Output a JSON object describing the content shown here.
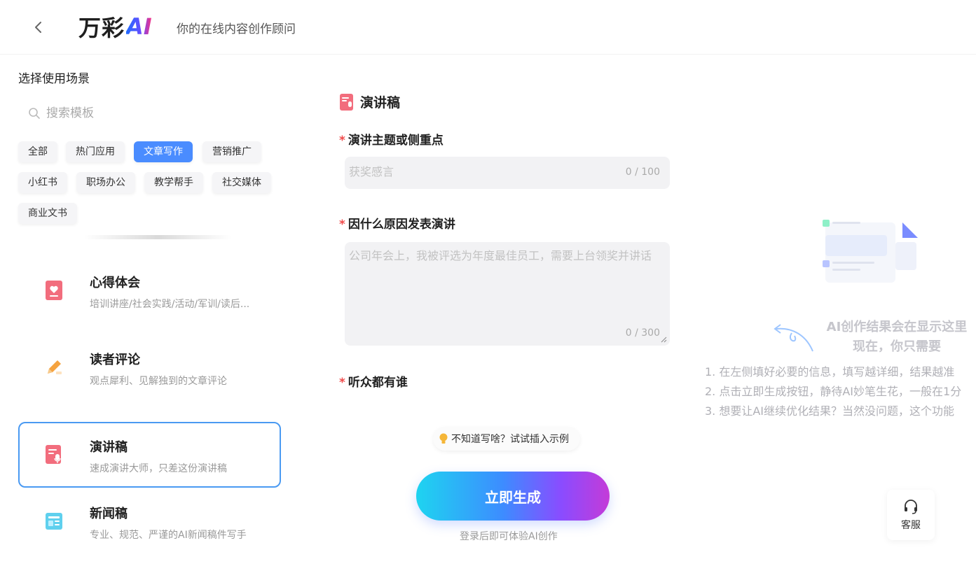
{
  "header": {
    "logo_cn": "万彩",
    "logo_ai": "AI",
    "slogan": "你的在线内容创作顾问"
  },
  "left": {
    "title": "选择使用场景",
    "search_placeholder": "搜索模板",
    "tags": [
      {
        "label": "全部",
        "active": false
      },
      {
        "label": "热门应用",
        "active": false
      },
      {
        "label": "文章写作",
        "active": true
      },
      {
        "label": "营销推广",
        "active": false
      },
      {
        "label": "小红书",
        "active": false
      },
      {
        "label": "职场办公",
        "active": false
      },
      {
        "label": "教学帮手",
        "active": false
      },
      {
        "label": "社交媒体",
        "active": false
      },
      {
        "label": "商业文书",
        "active": false
      }
    ],
    "cards": [
      {
        "title": "心得体会",
        "desc": "培训讲座/社会实践/活动/军训/读后...",
        "icon": "heart-doc-icon"
      },
      {
        "title": "读者评论",
        "desc": "观点犀利、见解独到的文章评论",
        "icon": "pencil-icon"
      },
      {
        "title": "演讲稿",
        "desc": "速成演讲大师，只差这份演讲稿",
        "icon": "speech-doc-icon",
        "active": true
      },
      {
        "title": "新闻稿",
        "desc": "专业、规范、严谨的AI新闻稿件写手",
        "icon": "news-icon"
      }
    ]
  },
  "form": {
    "title": "演讲稿",
    "fields": [
      {
        "label": "演讲主题或侧重点",
        "placeholder": "获奖感言",
        "count": "0 / 100"
      },
      {
        "label": "因什么原因发表演讲",
        "placeholder": "公司年会上，我被评选为年度最佳员工，需要上台领奖并讲话",
        "count": "0 / 300"
      },
      {
        "label": "听众都有谁"
      }
    ],
    "example_label": "不知道写啥？试试插入示例",
    "generate_label": "立即生成",
    "login_tip": "登录后即可体验AI创作"
  },
  "result": {
    "title_line1": "AI创作结果会在显示这里",
    "title_line2": "现在，你只需要",
    "steps": [
      "1. 在左侧填好必要的信息，填写越详细，结果越准",
      "2. 点击立即生成按钮，静待AI妙笔生花，一般在1分",
      "3. 想要让AI继续优化结果？当然没问题，这个功能"
    ]
  },
  "service": {
    "label": "客服"
  },
  "colors": {
    "accent": "#4a8cff",
    "active_border": "#4a9af2",
    "required": "#f04a4a"
  }
}
